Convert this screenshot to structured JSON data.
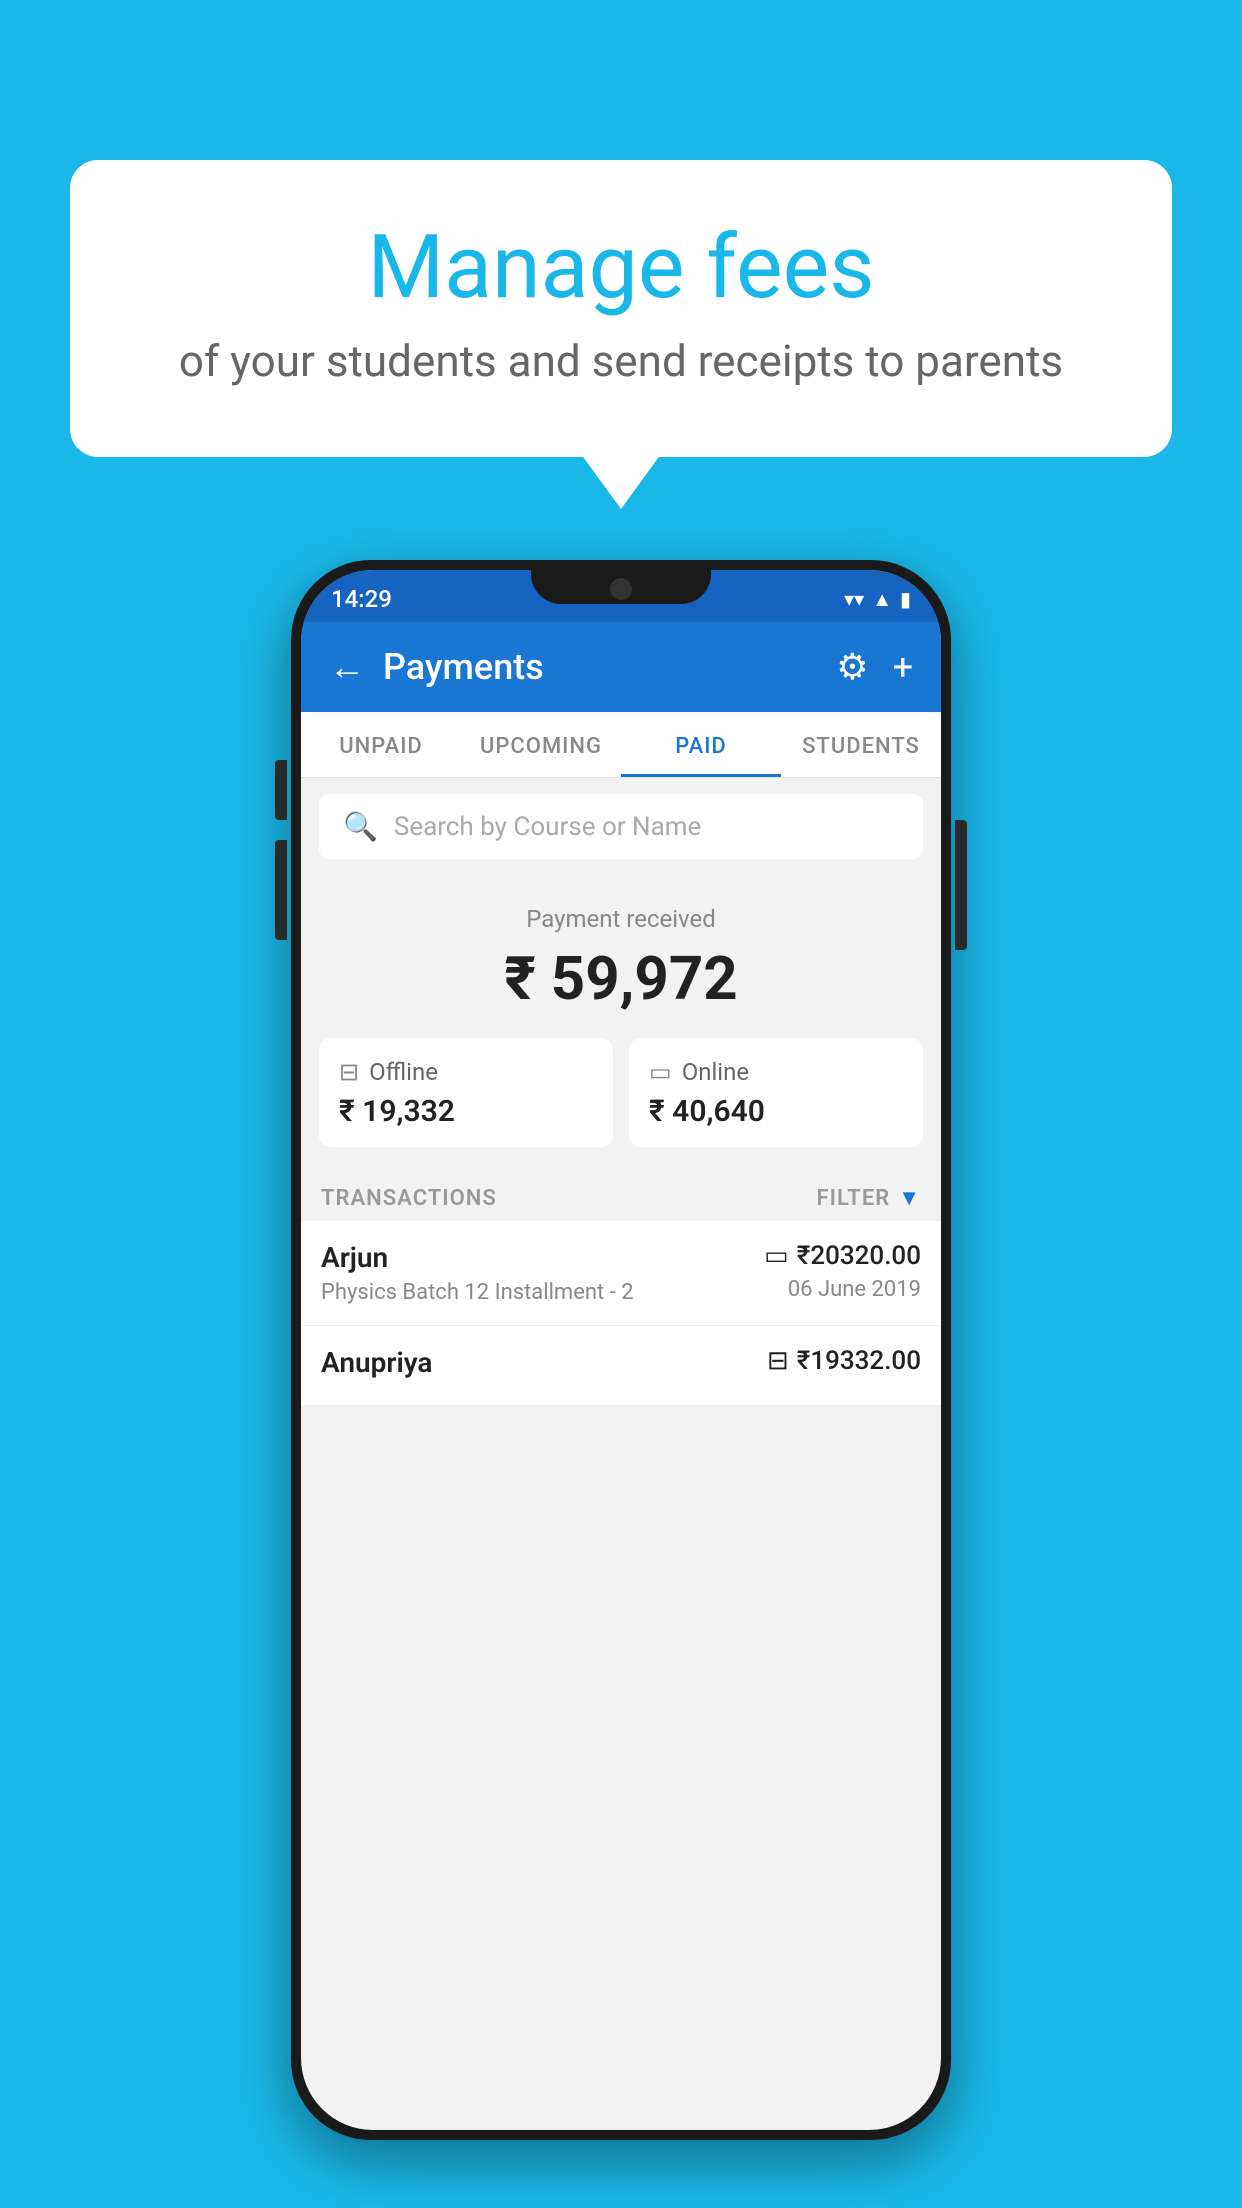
{
  "background_color": "#1ab8e8",
  "speech_bubble": {
    "title": "Manage fees",
    "subtitle": "of your students and send receipts to parents"
  },
  "status_bar": {
    "time": "14:29",
    "icons": [
      "wifi",
      "signal",
      "battery"
    ]
  },
  "header": {
    "title": "Payments",
    "back_label": "←",
    "settings_label": "⚙",
    "add_label": "+"
  },
  "tabs": [
    {
      "label": "UNPAID",
      "active": false
    },
    {
      "label": "UPCOMING",
      "active": false
    },
    {
      "label": "PAID",
      "active": true
    },
    {
      "label": "STUDENTS",
      "active": false
    }
  ],
  "search": {
    "placeholder": "Search by Course or Name"
  },
  "payment_summary": {
    "received_label": "Payment received",
    "amount": "₹ 59,972",
    "offline_label": "Offline",
    "offline_amount": "₹ 19,332",
    "online_label": "Online",
    "online_amount": "₹ 40,640"
  },
  "transactions": {
    "section_label": "TRANSACTIONS",
    "filter_label": "FILTER",
    "rows": [
      {
        "name": "Arjun",
        "detail": "Physics Batch 12 Installment - 2",
        "amount": "₹20320.00",
        "date": "06 June 2019",
        "payment_type": "card"
      },
      {
        "name": "Anupriya",
        "detail": "",
        "amount": "₹19332.00",
        "date": "",
        "payment_type": "cash"
      }
    ]
  }
}
